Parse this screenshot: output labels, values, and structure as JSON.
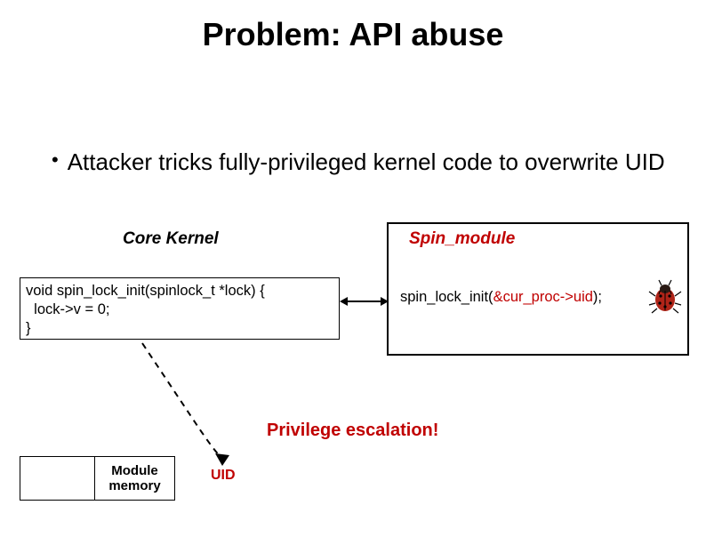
{
  "title": "Problem: API abuse",
  "bullet": "Attacker tricks fully-privileged kernel code to overwrite UID",
  "core_kernel_label": "Core Kernel",
  "spin_module_label": "Spin_module",
  "code_left_line1": "void spin_lock_init(spinlock_t *lock) {",
  "code_left_line2": "  lock->v = 0;",
  "code_left_line3": "}",
  "code_right_fn": "spin_lock_init(",
  "code_right_arg": "&cur_proc->uid",
  "code_right_tail": ");",
  "privesc_label": "Privilege escalation!",
  "mem_module_line1": "Module",
  "mem_module_line2": "memory",
  "uid_label": "UID"
}
